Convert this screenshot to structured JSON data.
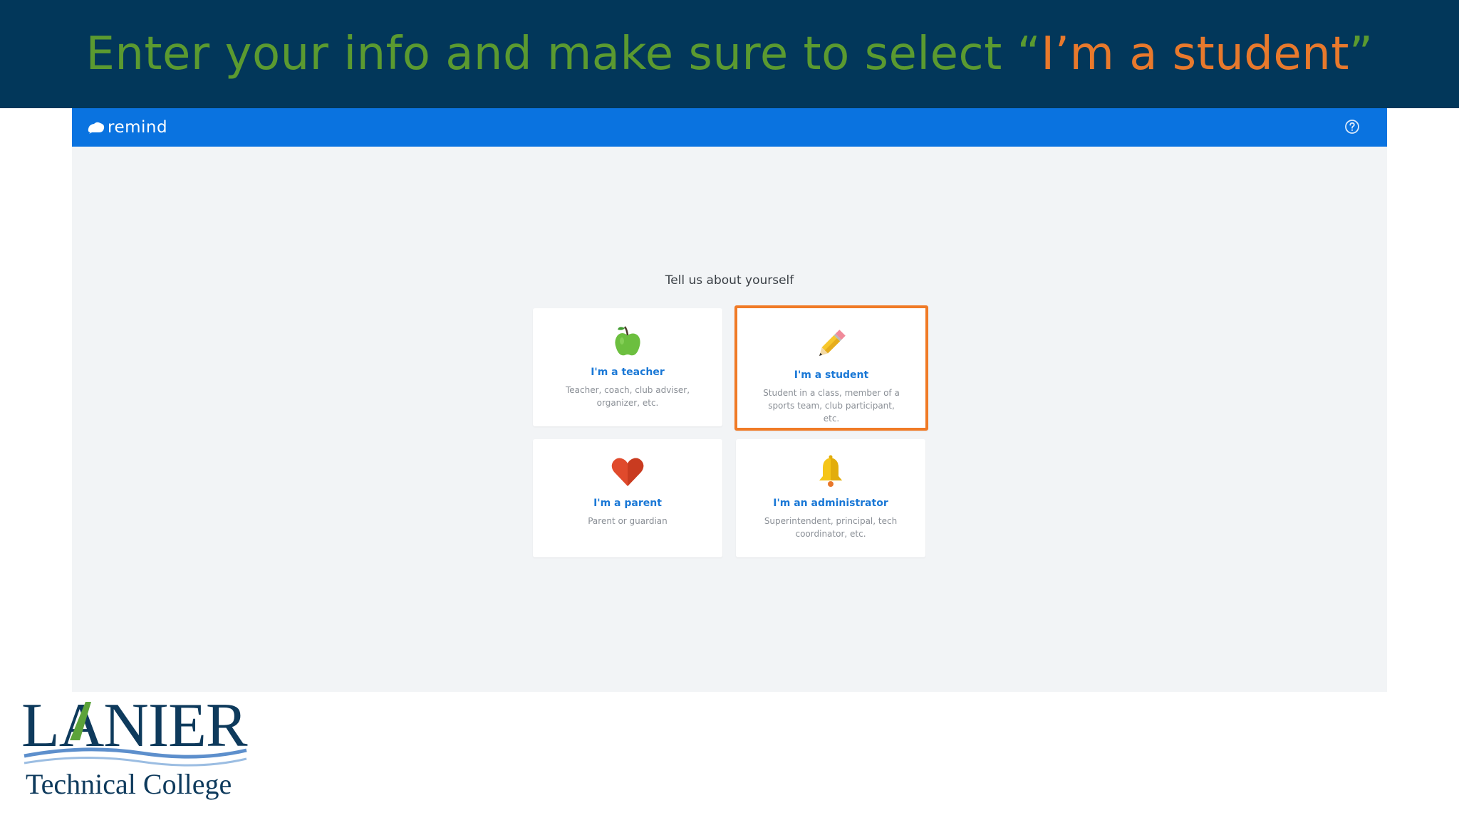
{
  "slide": {
    "title_prefix": "Enter your info and make sure to select “",
    "title_highlight": "I’m a student",
    "title_suffix": "”"
  },
  "app": {
    "logo_text": "remind",
    "prompt": "Tell us about yourself",
    "cards": [
      {
        "title": "I'm a teacher",
        "desc": "Teacher, coach, club adviser, organizer, etc.",
        "icon": "apple-icon"
      },
      {
        "title": "I'm a student",
        "desc": "Student in a class, member of a sports team, club participant, etc.",
        "icon": "pencil-icon"
      },
      {
        "title": "I'm a parent",
        "desc": "Parent or guardian",
        "icon": "heart-icon"
      },
      {
        "title": "I'm an administrator",
        "desc": "Superintendent, principal, tech coordinator, etc.",
        "icon": "bell-icon"
      }
    ]
  },
  "college": {
    "name": "LANIER",
    "subtitle": "Technical College"
  },
  "colors": {
    "banner": "#02375a",
    "title_green": "#5b9a30",
    "title_orange": "#e8792c",
    "app_header": "#0a73e0",
    "selection_border": "#f07a26",
    "card_title": "#1a78d6"
  }
}
